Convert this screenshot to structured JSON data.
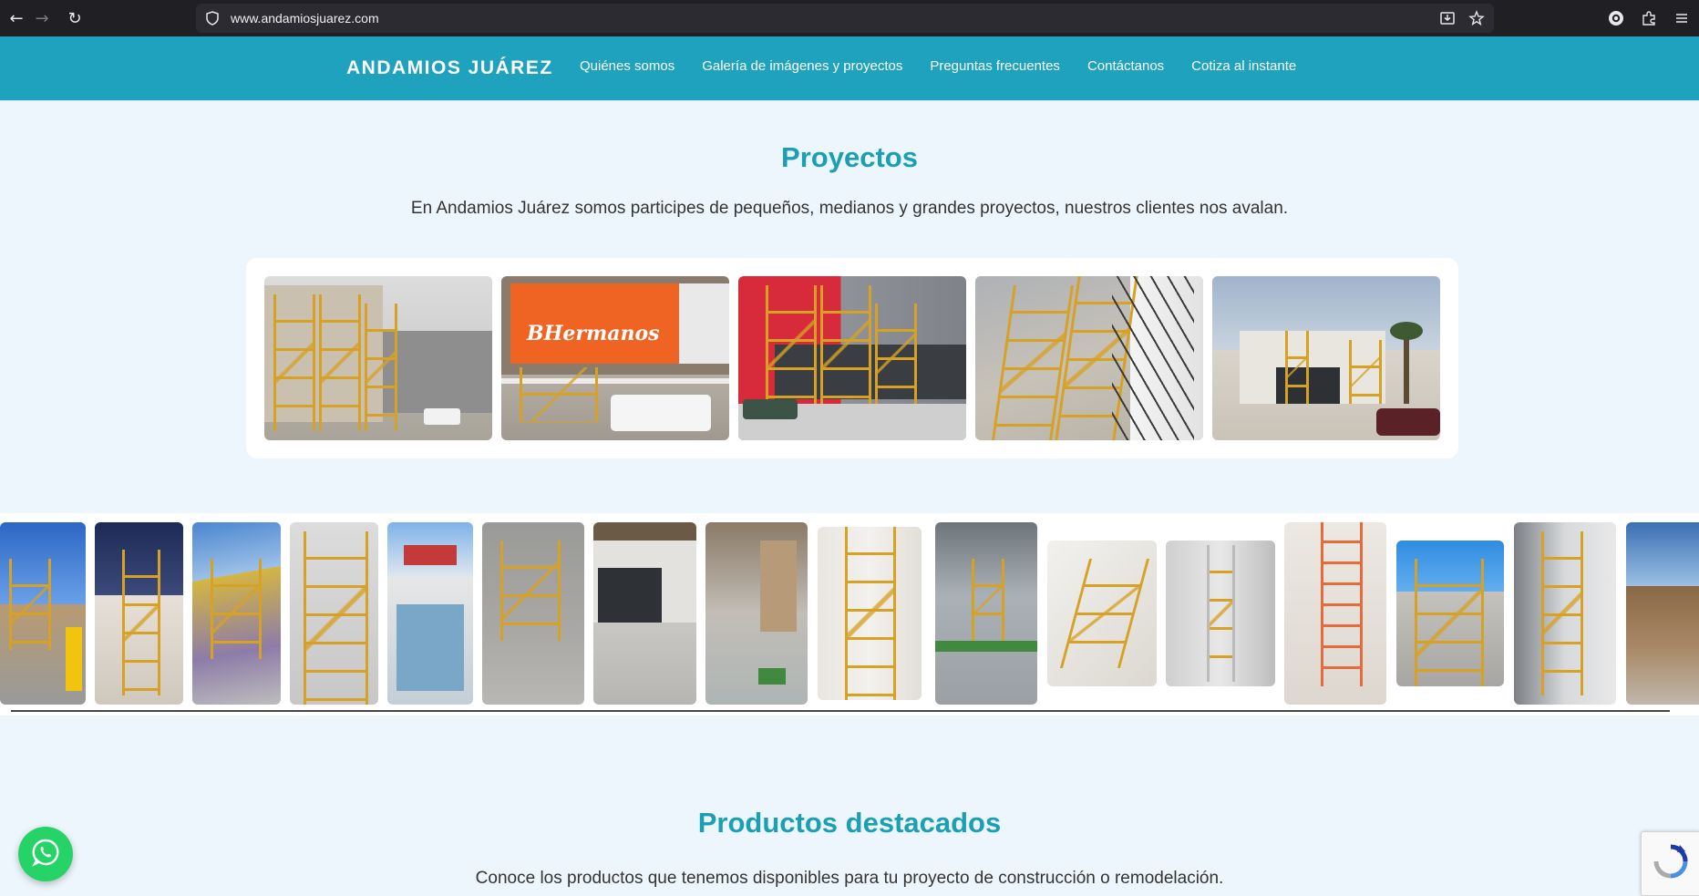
{
  "browser": {
    "url": "www.andamiosjuarez.com"
  },
  "site": {
    "brand": "ANDAMIOS JUÁREZ",
    "nav": [
      {
        "label": "Quiénes somos"
      },
      {
        "label": "Galería de imágenes y proyectos"
      },
      {
        "label": "Preguntas frecuentes"
      },
      {
        "label": "Contáctanos"
      },
      {
        "label": "Cotiza al instante"
      }
    ],
    "accent_color": "#1ea2bd"
  },
  "proyectos": {
    "title": "Proyectos",
    "text": "En Andamios Juárez somos participes de pequeños, medianos y grandes proyectos, nuestros clientes nos avalan.",
    "photo_sign": "BHermanos"
  },
  "productos": {
    "title": "Productos destacados",
    "text": "Conoce los productos que tenemos disponibles para tu proyecto de construcción o remodelación."
  }
}
